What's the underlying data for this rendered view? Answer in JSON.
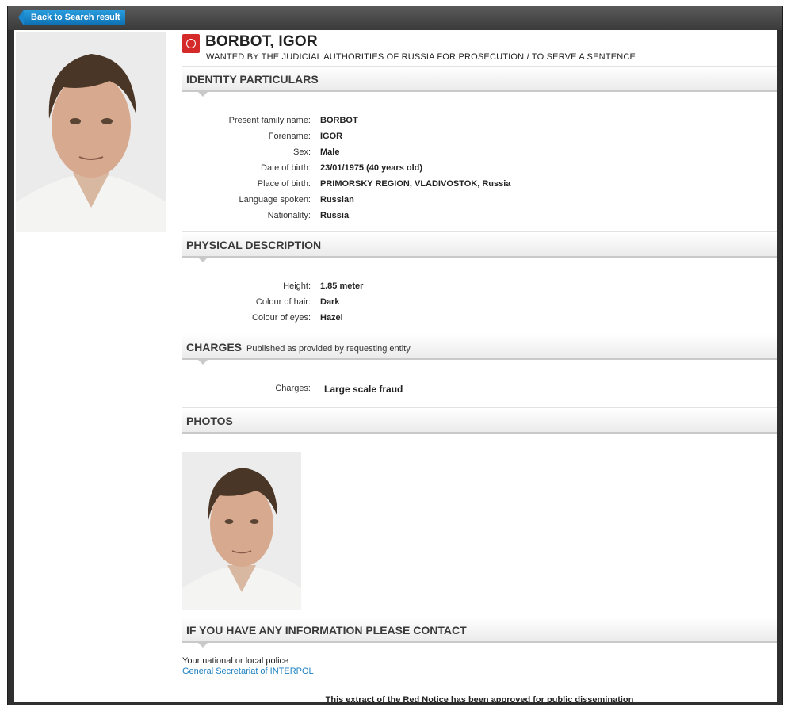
{
  "nav": {
    "back_label": "Back to Search result"
  },
  "person": {
    "name": "BORBOT, IGOR",
    "subtitle": "WANTED BY THE JUDICIAL AUTHORITIES OF RUSSIA FOR PROSECUTION / TO SERVE A SENTENCE"
  },
  "identity": {
    "title": "IDENTITY PARTICULARS",
    "rows": [
      {
        "label": "Present family name:",
        "value": "BORBOT"
      },
      {
        "label": "Forename:",
        "value": "IGOR"
      },
      {
        "label": "Sex:",
        "value": "Male"
      },
      {
        "label": "Date of birth:",
        "value": "23/01/1975 (40 years old)"
      },
      {
        "label": "Place of birth:",
        "value": "PRIMORSKY REGION, VLADIVOSTOK, Russia"
      },
      {
        "label": "Language spoken:",
        "value": "Russian"
      },
      {
        "label": "Nationality:",
        "value": "Russia"
      }
    ]
  },
  "physical": {
    "title": "PHYSICAL DESCRIPTION",
    "rows": [
      {
        "label": "Height:",
        "value": "1.85 meter"
      },
      {
        "label": "Colour of hair:",
        "value": "Dark"
      },
      {
        "label": "Colour of eyes:",
        "value": "Hazel"
      }
    ]
  },
  "charges": {
    "title": "CHARGES",
    "subtitle": "Published as provided by requesting entity",
    "label": "Charges:",
    "value": "Large scale fraud"
  },
  "photos": {
    "title": "PHOTOS"
  },
  "contact": {
    "title": "IF YOU HAVE ANY INFORMATION PLEASE CONTACT",
    "line1": "Your national or local police",
    "link": "General Secretariat of INTERPOL"
  },
  "footer": "This extract of the Red Notice has been approved for public dissemination",
  "colors": {
    "accent_blue": "#1a7fc1",
    "logo_red": "#d42a2a",
    "frame_dark": "#2f2f2f"
  }
}
